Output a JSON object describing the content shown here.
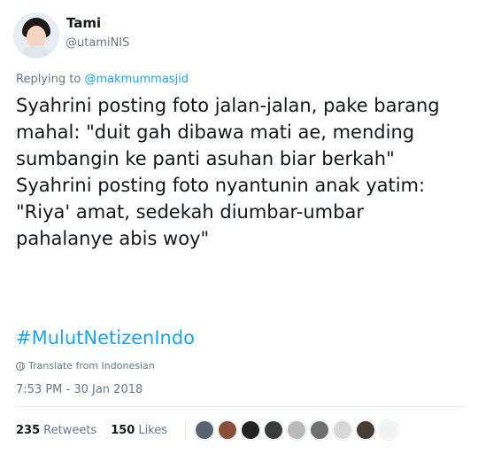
{
  "author": {
    "display_name": "Tami",
    "handle": "@utamiNIS"
  },
  "reply": {
    "prefix": "Replying to ",
    "mention": "@makmummasjid"
  },
  "tweet": {
    "text": "Syahrini posting foto jalan-jalan, pake barang\nmahal: \"duit gah dibawa mati ae, mending\nsumbangin ke panti asuhan biar berkah\"\nSyahrini posting foto nyantunin anak yatim:\n\"Riya' amat, sedekah diumbar-umbar\npahalanye abis woy\"",
    "hashtag": "#MulutNetizenIndo",
    "translate_label": "Translate from Indonesian",
    "timestamp": "7:53 PM - 30 Jan 2018"
  },
  "stats": {
    "retweets_count": "235",
    "retweets_label": "Retweets",
    "likes_count": "150",
    "likes_label": "Likes"
  },
  "likers": [
    {
      "icon": "liker-avatar",
      "color": "#5a6470"
    },
    {
      "icon": "liker-avatar",
      "color": "#8a4e3b"
    },
    {
      "icon": "liker-avatar",
      "color": "#222222"
    },
    {
      "icon": "liker-avatar",
      "color": "#3b3b3b"
    },
    {
      "icon": "liker-avatar",
      "color": "#b9b9b9"
    },
    {
      "icon": "liker-avatar",
      "color": "#6f6f6f"
    },
    {
      "icon": "liker-avatar",
      "color": "#d8d8d8"
    },
    {
      "icon": "liker-avatar",
      "color": "#4a3b35"
    },
    {
      "icon": "liker-avatar",
      "color": "#f2f2f2"
    }
  ],
  "colors": {
    "accent": "#1da1f2",
    "muted": "#657786",
    "text": "#14171a"
  }
}
